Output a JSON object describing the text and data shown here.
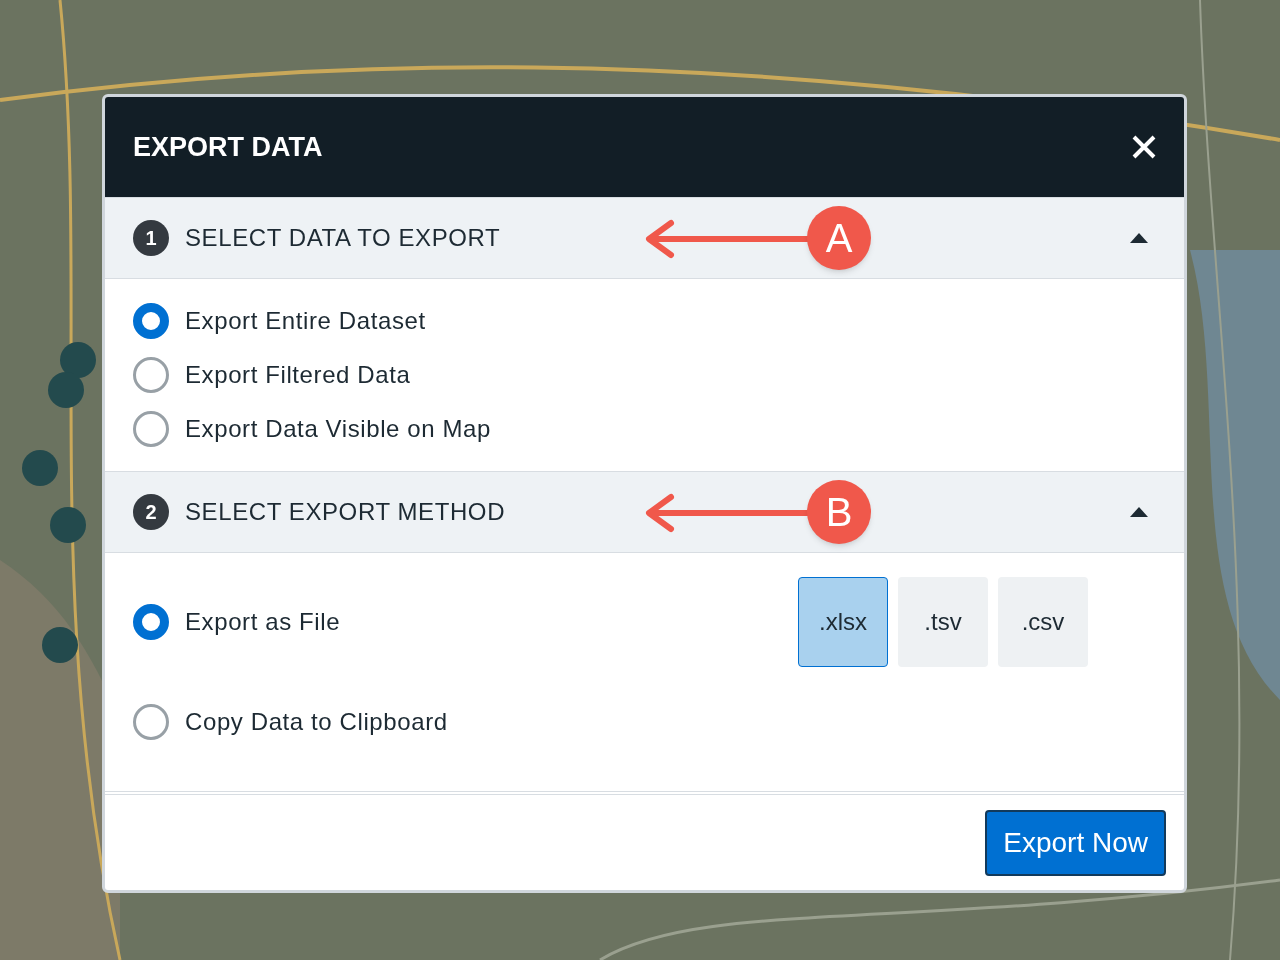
{
  "dialog": {
    "title": "EXPORT DATA",
    "sections": [
      {
        "number": "1",
        "title": "SELECT DATA TO EXPORT",
        "expanded": true,
        "callout": "A",
        "options": [
          {
            "label": "Export Entire Dataset",
            "selected": true
          },
          {
            "label": "Export Filtered Data",
            "selected": false
          },
          {
            "label": "Export Data Visible on Map",
            "selected": false
          }
        ]
      },
      {
        "number": "2",
        "title": "SELECT EXPORT METHOD",
        "expanded": true,
        "callout": "B",
        "options": [
          {
            "label": "Export as File",
            "selected": true,
            "formats": [
              {
                "label": ".xlsx",
                "selected": true
              },
              {
                "label": ".tsv",
                "selected": false
              },
              {
                "label": ".csv",
                "selected": false
              }
            ]
          },
          {
            "label": "Copy Data to Clipboard",
            "selected": false
          }
        ]
      }
    ],
    "primary_button": "Export Now"
  }
}
